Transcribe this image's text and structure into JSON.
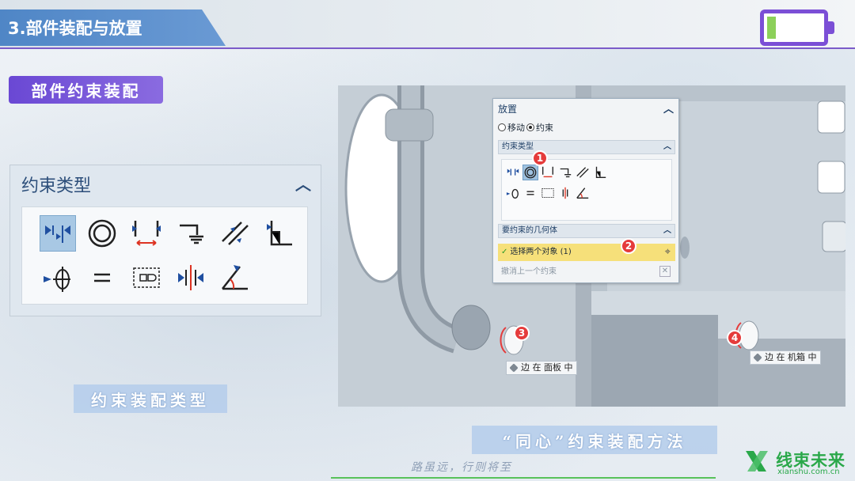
{
  "header": {
    "title": "3.部件装配与放置"
  },
  "section_tag": "部件约束装配",
  "panel": {
    "title": "约束类型",
    "tools_row1": [
      "touch-align-icon",
      "concentric-icon",
      "distance-icon",
      "fix-icon",
      "parallel-icon",
      "perpendicular-icon"
    ],
    "tools_row2": [
      "fit-icon",
      "bond-icon",
      "center-icon",
      "align-lock-icon",
      "angle-icon"
    ]
  },
  "captions": {
    "left": "约束装配类型",
    "right": "“同心”约束装配方法"
  },
  "dialog": {
    "title": "放置",
    "radio_move": "移动",
    "radio_constraint": "约束",
    "section_types": "约束类型",
    "section_geometry": "要约束的几何体",
    "select_text": "选择两个对象 (1)",
    "undo_text": "撤消上一个约束"
  },
  "badges": [
    "1",
    "2",
    "3",
    "4"
  ],
  "edge_labels": {
    "panel": "边 在 面板 中",
    "box": "边 在 机箱 中"
  },
  "footer": {
    "slogan": "路虽远，行则将至",
    "logo_name": "线束未来",
    "logo_url": "xianshu.com.cn"
  },
  "colors": {
    "accent_purple": "#7b4fd6",
    "header_blue": "#4f86c6",
    "battery_green": "#8cd05a",
    "logo_green": "#2aa84a",
    "badge_red": "#e53b3b"
  }
}
